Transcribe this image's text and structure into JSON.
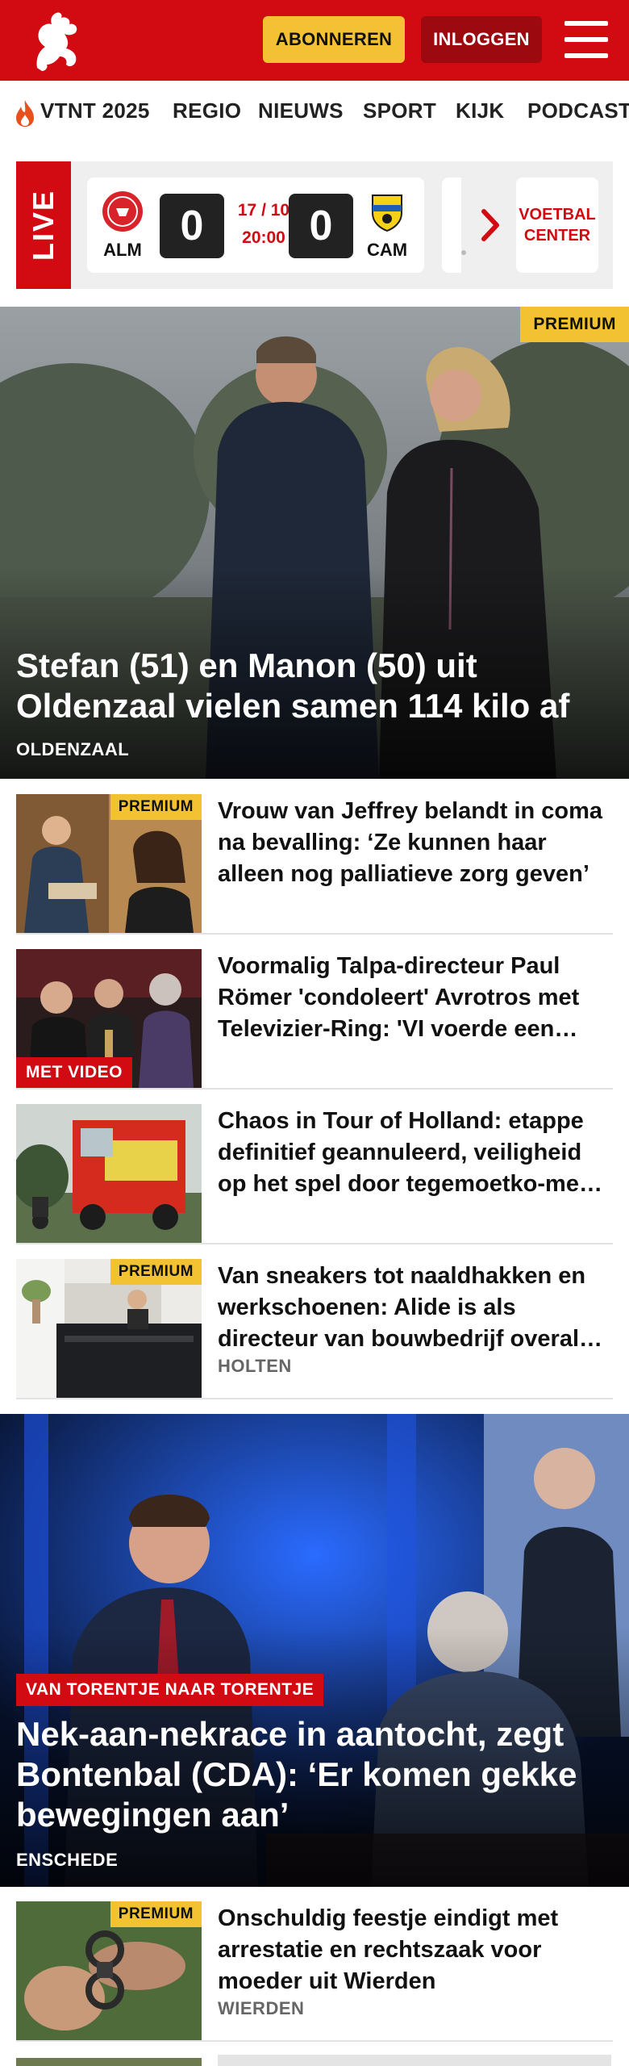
{
  "header": {
    "subscribe_label": "ABONNEREN",
    "login_label": "INLOGGEN",
    "brand_color": "#d20a11"
  },
  "nav": {
    "items": [
      "VTNT 2025",
      "REGIO",
      "NIEUWS",
      "SPORT",
      "KIJK",
      "PODCAST"
    ]
  },
  "live": {
    "label": "LIVE",
    "match": {
      "home_abbr": "ALM",
      "away_abbr": "CAM",
      "home_score": "0",
      "away_score": "0",
      "date": "17 / 10",
      "time": "20:00"
    },
    "voetbal_center_line1": "VOETBAL",
    "voetbal_center_line2": "CENTER"
  },
  "hero": {
    "badge": "PREMIUM",
    "title": "Stefan (51) en Manon (50) uit Oldenzaal vielen samen 114 kilo af",
    "location": "OLDENZAAL"
  },
  "articles": [
    {
      "badge": "PREMIUM",
      "title": "Vrouw van Jeffrey belandt in coma na bevalling: ‘Ze kunnen haar alleen nog palliatieve zorg geven’",
      "location": ""
    },
    {
      "badge": "MET VIDEO",
      "title": "Voormalig Talpa-directeur Paul Römer 'condoleert' Avrotros met Televizier-Ring: 'VI voerde een campagne'",
      "location": ""
    },
    {
      "badge": "",
      "title": "Chaos in Tour of Holland: etappe definitief geannuleerd, veiligheid op het spel door tegemoetko-mend verkeer",
      "location": ""
    },
    {
      "badge": "PREMIUM",
      "title": "Van sneakers tot naaldhakken en werkschoenen: Alide is als directeur van bouwbedrijf overal thuis",
      "location": "HOLTEN"
    }
  ],
  "hero2": {
    "label": "VAN TORENTJE NAAR TORENTJE",
    "title": "Nek-aan-nekrace in aantocht, zegt Bontenbal (CDA): ‘Er komen gekke bewegingen aan’",
    "location": "ENSCHEDE"
  },
  "articles2": [
    {
      "badge": "PREMIUM",
      "title": "Onschuldig feestje eindigt met arrestatie en rechtszaak voor moeder uit Wierden",
      "location": "WIERDEN"
    }
  ]
}
